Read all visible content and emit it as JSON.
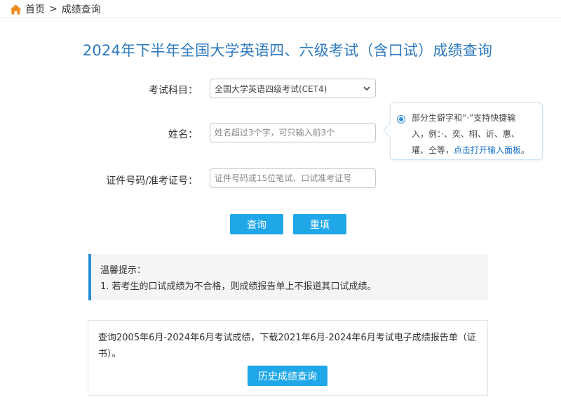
{
  "breadcrumb": {
    "home": "首页",
    "separator": ">",
    "current": "成绩查询"
  },
  "page_title": "2024年下半年全国大学英语四、六级考试（含口试）成绩查询",
  "form": {
    "subject_label": "考试科目：",
    "subject_value": "全国大学英语四级考试(CET4)",
    "name_label": "姓名：",
    "name_placeholder": "姓名超过3个字，可只输入前3个",
    "id_label": "证件号码/准考证号：",
    "id_placeholder": "证件号码或15位笔试、口试准考证号"
  },
  "tip": {
    "line1": "部分生僻字和“·”支持快捷输",
    "line2": "入，例：·、奕、栩、䜣、惠、",
    "line3_text": "瓘、仝等，",
    "line3_link": "点击打开输入面板",
    "line3_end": "。"
  },
  "buttons": {
    "query": "查询",
    "reset": "重填",
    "history": "历史成绩查询"
  },
  "notice": {
    "title": "温馨提示：",
    "item1": "1. 若考生的口试成绩为不合格，则成绩报告单上不报道其口试成绩。"
  },
  "history": {
    "text_line1": "查询2005年6月-2024年6月考试成绩，下载2021年6月-2024年6月考试电子成绩报告单（证",
    "text_line2": "书）。"
  },
  "colors": {
    "accent": "#1fa7e8",
    "title": "#2f7bbf",
    "home_icon": "#f08a24"
  }
}
